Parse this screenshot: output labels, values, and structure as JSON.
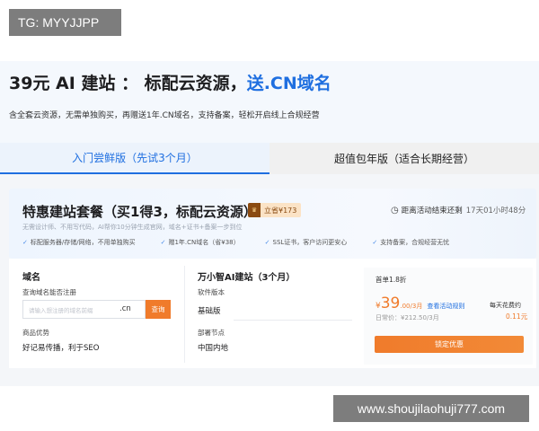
{
  "watermark_top": "TG: MYYJJPP",
  "watermark_bottom": "www.shoujilaohuji777.com",
  "hero": {
    "title_main": "39元 AI 建站 ： 标配云资源，",
    "title_highlight": "送.CN域名",
    "subtitle": "含全套云资源，无需单独购买，再赠送1年.CN域名，支持备案，轻松开启线上合规经营"
  },
  "tabs": [
    {
      "label": "入门尝鲜版（先试3个月）",
      "active": true
    },
    {
      "label": "超值包年版（适合长期经营）",
      "active": false
    }
  ],
  "package": {
    "title": "特惠建站套餐（买1得3，标配云资源）",
    "save_badge": "立省¥173",
    "crown_icon": "crown-icon",
    "countdown_label": "距离活动结束还剩",
    "countdown_time": "17天01小时48分",
    "description": "无需设计师、不用写代码，AI帮你10分钟生成官网，域名+证书+备案一步到位",
    "features": [
      "标配服务器/存储/网络，不用单独购买",
      "赠1年.CN域名（省¥38）",
      "SSL证书，客户访问更安心",
      "支持备案，合规经营无忧"
    ]
  },
  "domain": {
    "heading": "域名",
    "query_label": "查询域名能否注册",
    "input_placeholder": "请输入想注册的域名前缀",
    "suffix": ".cn",
    "query_button": "查询",
    "advantage_label": "商品优势",
    "advantage_value": "好记易传播，利于SEO"
  },
  "site": {
    "heading": "万小智AI建站（3个月）",
    "version_label": "软件版本",
    "version_value": "基础版",
    "node_label": "部署节点",
    "node_value": "中国内地"
  },
  "pricing": {
    "first_year": "首单1.8折",
    "currency": "¥",
    "price": "39",
    "price_unit": ".00/3月",
    "detail_link": "查看活动规则",
    "original": "日常价：¥212.50/3月",
    "daily_label": "每天花费约",
    "daily_value": "0.11元",
    "lock_button": "锁定优惠"
  },
  "colors": {
    "accent_blue": "#1f6fe0",
    "accent_orange": "#f07b2b"
  }
}
